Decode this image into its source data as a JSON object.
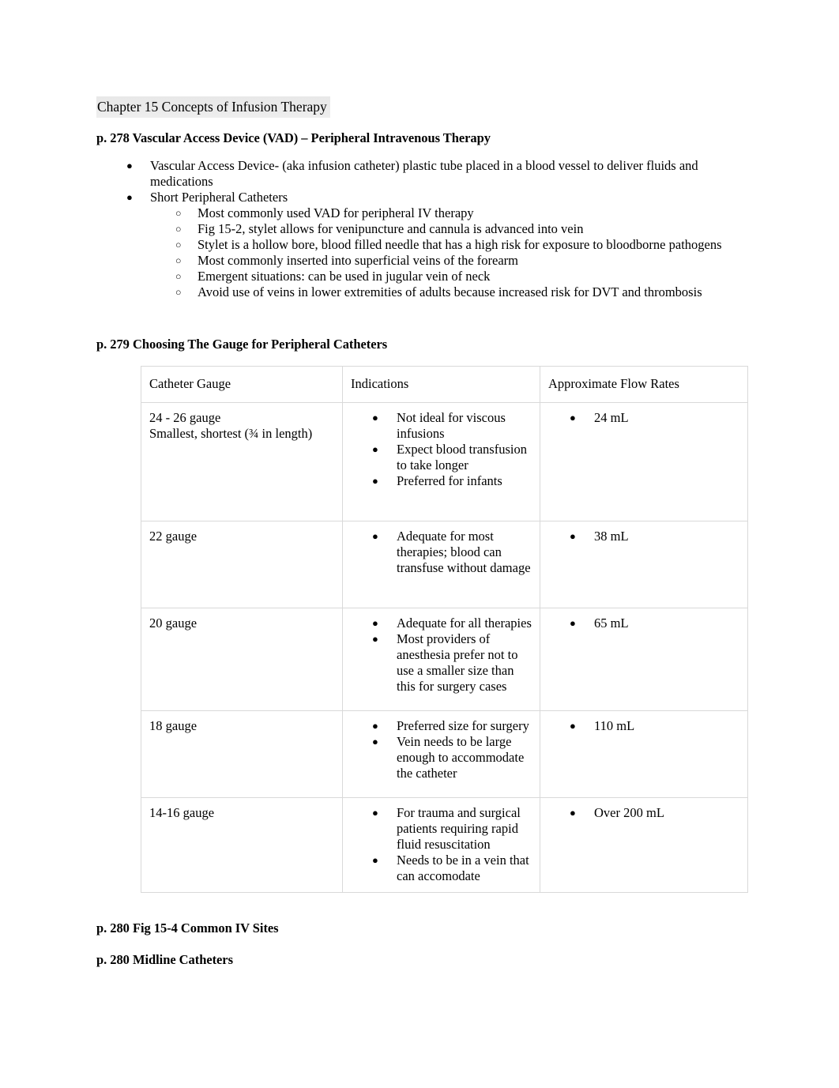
{
  "document": {
    "title": "Chapter 15 Concepts of Infusion Therapy"
  },
  "headings": {
    "vad": "p. 278 Vascular Access Device (VAD) – Peripheral Intravenous  Therapy",
    "gauge": "p. 279 Choosing The Gauge for Peripheral Catheters",
    "iv_sites": "p. 280 Fig 15-4 Common IV Sites",
    "midline": "p. 280 Midline Catheters"
  },
  "bullets": {
    "disc": "●",
    "circle": "○"
  },
  "outline": [
    {
      "level": 1,
      "text": "Vascular Access Device- (aka infusion catheter) plastic tube placed in a blood vessel to deliver fluids and medications"
    },
    {
      "level": 1,
      "text": "Short Peripheral Catheters"
    },
    {
      "level": 2,
      "text": "Most commonly used VAD for peripheral IV therapy"
    },
    {
      "level": 2,
      "text": "Fig 15-2, stylet allows for venipuncture and cannula is advanced into vein"
    },
    {
      "level": 2,
      "text": "Stylet is a hollow bore, blood filled needle that has a high risk for exposure to bloodborne pathogens"
    },
    {
      "level": 2,
      "text": "Most commonly inserted into superficial veins of the forearm"
    },
    {
      "level": 2,
      "text": "Emergent situations: can be used in jugular vein of neck"
    },
    {
      "level": 2,
      "text": "Avoid use of veins in lower extremities of adults because increased risk for DVT and thrombosis"
    }
  ],
  "table": {
    "columns": [
      "Catheter Gauge",
      "Indications",
      "Approximate Flow Rates"
    ],
    "rows": [
      {
        "gauge": "24 - 26 gauge\nSmallest, shortest (¾ in length)",
        "indications": [
          "Not ideal for viscous infusions",
          "Expect blood transfusion to take longer",
          "Preferred for infants"
        ],
        "flow_rates": [
          "24 mL"
        ]
      },
      {
        "gauge": "22 gauge",
        "indications": [
          "Adequate for most therapies; blood can transfuse without damage"
        ],
        "flow_rates": [
          "38 mL"
        ]
      },
      {
        "gauge": "20 gauge",
        "indications": [
          "Adequate for all therapies",
          "Most providers of anesthesia prefer not to use a smaller size than this for surgery cases"
        ],
        "flow_rates": [
          "65 mL"
        ]
      },
      {
        "gauge": "18 gauge",
        "indications": [
          "Preferred size for surgery",
          "Vein needs to be large enough to accommodate the catheter"
        ],
        "flow_rates": [
          "110 mL"
        ]
      },
      {
        "gauge": "14-16 gauge",
        "indications": [
          "For trauma and surgical patients requiring rapid fluid resuscitation",
          "Needs to be in a vein that can accomodate"
        ],
        "flow_rates": [
          "Over 200 mL"
        ]
      }
    ]
  },
  "colors": {
    "text": "#000000",
    "page_background": "#ffffff",
    "table_border": "#d9d9d9",
    "title_highlight": "#e9e9e9"
  }
}
